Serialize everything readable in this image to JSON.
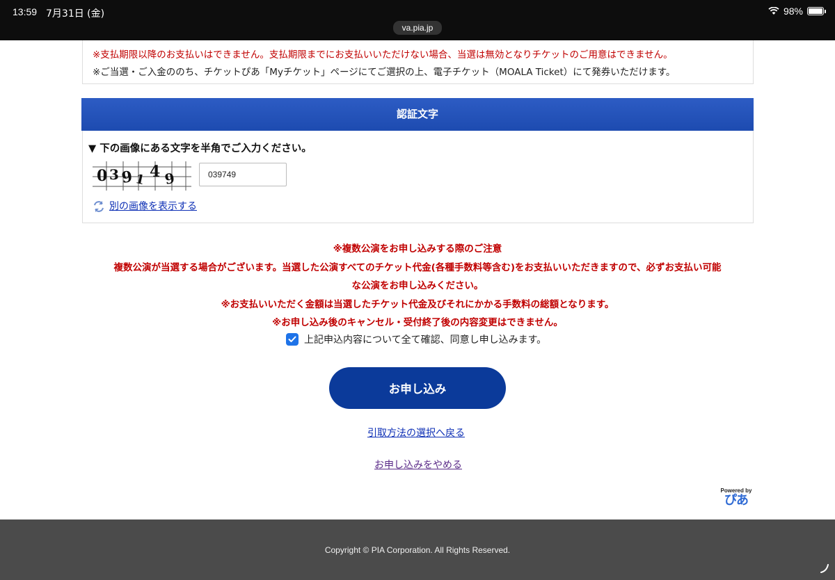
{
  "status_bar": {
    "time": "13:59",
    "date": "7月31日 (金)",
    "battery": "98%",
    "battery_level": 0.98,
    "url": "va.pia.jp"
  },
  "notes": {
    "payment_deadline": "※支払期限以降のお支払いはできません。支払期限までにお支払いいただけない場合、当選は無効となりチケットのご用意はできません。",
    "ticket_issue": "※ご当選・ご入金ののち、チケットぴあ「Myチケット」ページにてご選択の上、電子チケット（MOALA Ticket）にて発券いただけます。"
  },
  "captcha": {
    "header": "認証文字",
    "instruction": "▼ 下の画像にある文字を半角でご入力ください。",
    "image_text": "039149",
    "input_value": "039749",
    "reload_label": "別の画像を表示する"
  },
  "warnings": {
    "title": "※複数公演をお申し込みする際のご注意",
    "line1": "複数公演が当選する場合がございます。当選した公演すべてのチケット代金(各種手数料等含む)をお支払いいただきますので、必ずお支払い可能",
    "line2": "な公演をお申し込みください。",
    "line3": "※お支払いいただく金額は当選したチケット代金及びそれにかかる手数料の総額となります。",
    "line4": "※お申し込み後のキャンセル・受付終了後の内容変更はできません。"
  },
  "agree": {
    "label": "上記申込内容について全て確認、同意し申し込みます。",
    "checked": true
  },
  "actions": {
    "submit_label": "お申し込み",
    "back_label": "引取方法の選択へ戻る",
    "cancel_label": "お申し込みをやめる"
  },
  "branding": {
    "powered_by": "Powered by",
    "logo_text": "ぴあ"
  },
  "footer": {
    "copyright": "Copyright © PIA Corporation. All Rights Reserved."
  },
  "colors": {
    "header_blue": "#1d4bb0",
    "button_blue": "#0b3a9a",
    "warning_red": "#c00000",
    "link_blue": "#0d2fb5",
    "footer_gray": "#4b4b4b"
  },
  "icons": [
    "wifi-icon",
    "battery-icon",
    "reload-icon",
    "checkmark-icon"
  ]
}
